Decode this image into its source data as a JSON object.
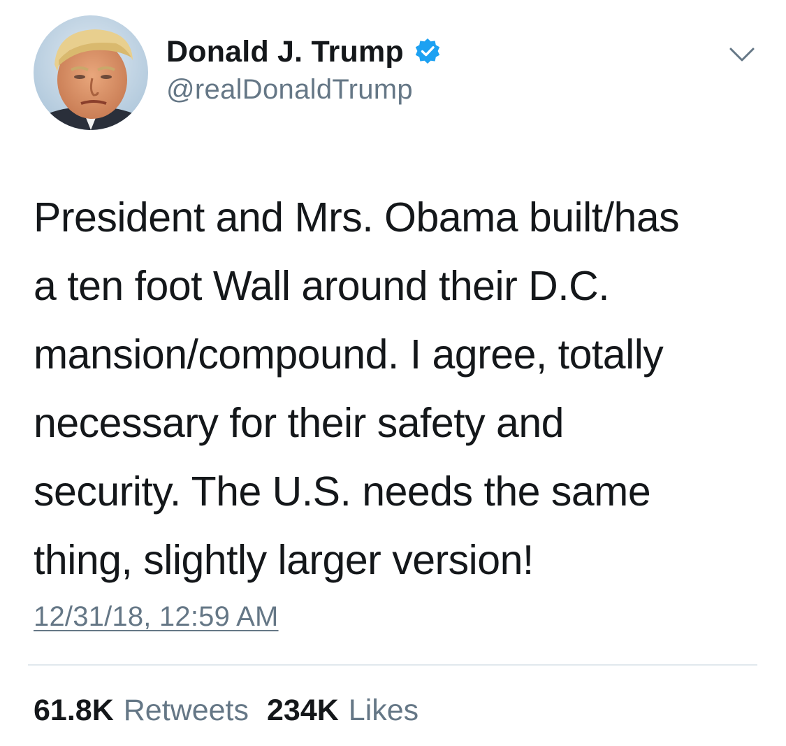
{
  "author": {
    "display_name": "Donald J. Trump",
    "handle": "@realDonaldTrump",
    "verified": true,
    "avatar_icon": "profile-photo"
  },
  "tweet": {
    "text_lines": [
      "President and Mrs. Obama built/has",
      "a ten foot Wall around their D.C.",
      "mansion/compound. I agree, totally",
      "necessary for their safety and",
      "security. The U.S. needs the same",
      "thing, slightly larger version!"
    ],
    "timestamp": "12/31/18, 12:59 AM"
  },
  "stats": {
    "retweets_count": "61.8K",
    "retweets_label": "Retweets",
    "likes_count": "234K",
    "likes_label": "Likes"
  },
  "icons": {
    "verified": "verified-badge-icon",
    "menu": "chevron-down-icon"
  },
  "colors": {
    "text_primary": "#14171a",
    "text_secondary": "#657786",
    "verified_blue": "#1da1f2",
    "divider": "#e1e8ed"
  }
}
